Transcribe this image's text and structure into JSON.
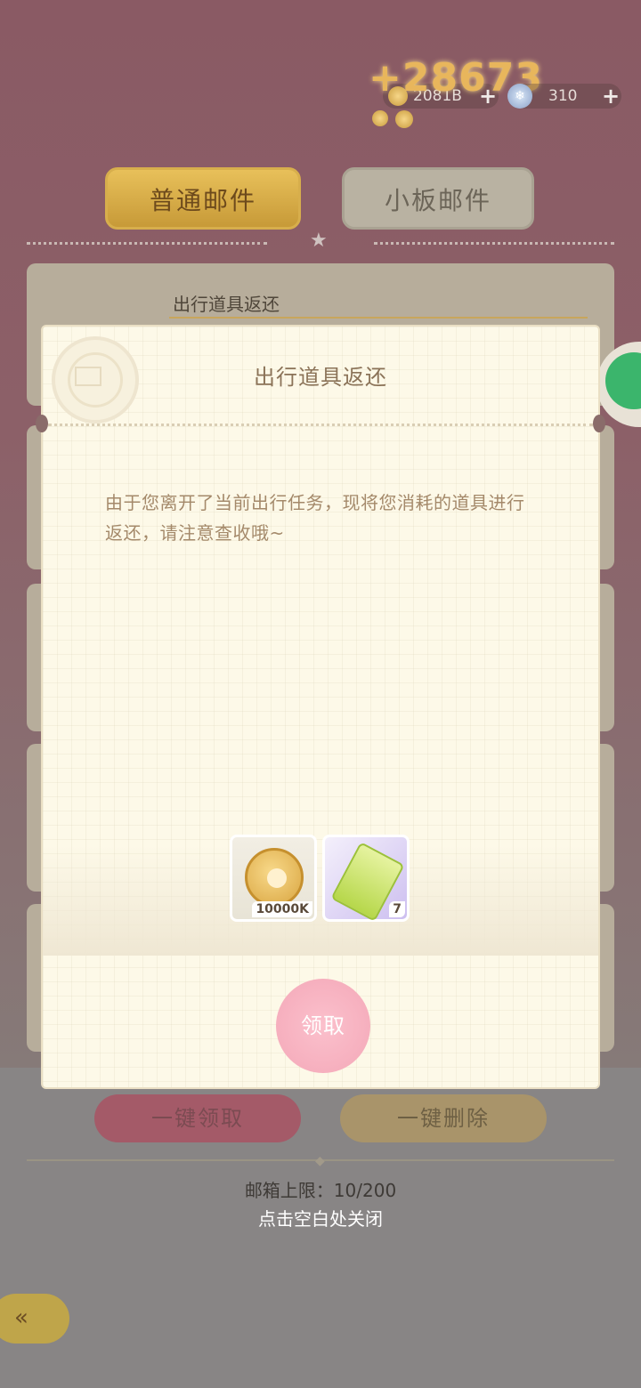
{
  "currency": {
    "gain": "+28673",
    "coins": "2081B",
    "gems": "310"
  },
  "tabs": [
    {
      "label": "普通邮件",
      "active": true
    },
    {
      "label": "小板邮件",
      "active": false
    }
  ],
  "mail_list": [
    {
      "title": "出行道具返还"
    }
  ],
  "modal": {
    "title": "出行道具返还",
    "body": "由于您离开了当前出行任务，现将您消耗的道具进行返还，请注意查收哦~",
    "items": [
      {
        "icon": "coin-icon",
        "quantity": "10000K"
      },
      {
        "icon": "ticket-icon",
        "quantity": "7"
      }
    ],
    "claim_label": "领取"
  },
  "footer": {
    "claim_all_label": "一键领取",
    "delete_all_label": "一键删除",
    "limit_text": "邮箱上限：10/200",
    "close_hint": "点击空白处关闭"
  },
  "colors": {
    "accent_gold": "#e8c05a",
    "claim_pink": "#f4a8b8",
    "modal_bg": "#fdf9e8"
  }
}
